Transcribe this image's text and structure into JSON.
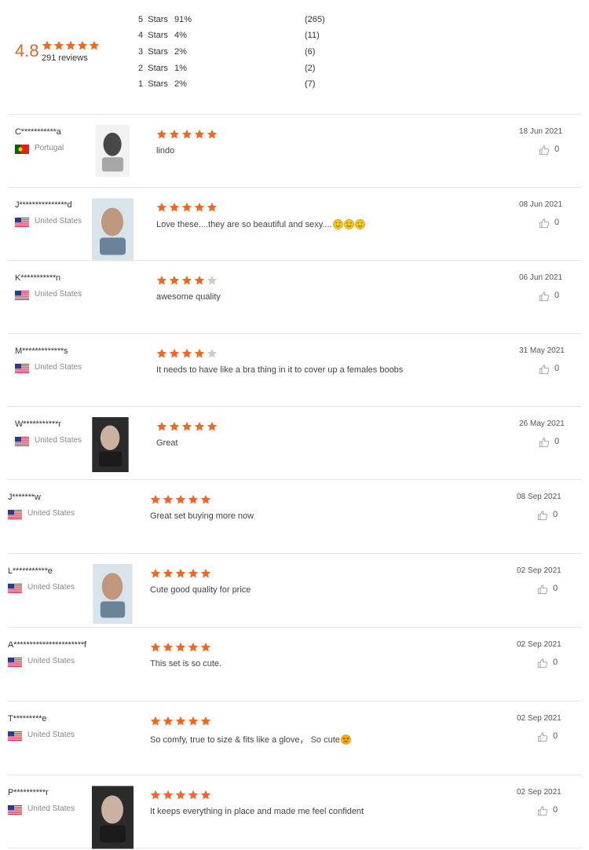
{
  "summary": {
    "average": "4.8",
    "total_reviews": "291 reviews",
    "distribution": [
      {
        "label": "5  Stars",
        "percent": "91%",
        "count": "(265)"
      },
      {
        "label": "4  Stars",
        "percent": "4%",
        "count": "(11)"
      },
      {
        "label": "3  Stars",
        "percent": "2%",
        "count": "(6)"
      },
      {
        "label": "2  Stars",
        "percent": "1%",
        "count": "(2)"
      },
      {
        "label": "1  Stars",
        "percent": "2%",
        "count": "(7)"
      }
    ]
  },
  "colors": {
    "star_filled": "#f26522",
    "star_empty": "#cccccc",
    "accent": "#e8641b"
  },
  "reviews": [
    {
      "name": "C***********a",
      "country": "Portugal",
      "flag": "portugal-flag",
      "has_photo": true,
      "stars": 5,
      "text": "lindo",
      "emojis": [],
      "date": "18 Jun 2021",
      "likes": "0"
    },
    {
      "name": "J***************d",
      "country": "United States",
      "flag": "us-flag",
      "has_photo": true,
      "stars": 5,
      "text": "Love these....they are so beautiful and sexy....",
      "emojis": [
        "smile-emoji",
        "smile-emoji",
        "smile-emoji"
      ],
      "date": "08 Jun 2021",
      "likes": "0"
    },
    {
      "name": "K***********n",
      "country": "United States",
      "flag": "us-flag",
      "has_photo": false,
      "stars": 4,
      "text": "awesome quality",
      "emojis": [],
      "date": "06 Jun 2021",
      "likes": "0"
    },
    {
      "name": "M*************s",
      "country": "United States",
      "flag": "us-flag",
      "has_photo": false,
      "stars": 4,
      "text": "It needs to have like a bra thing in it to cover up a females boobs",
      "emojis": [],
      "date": "31 May 2021",
      "likes": "0"
    },
    {
      "name": "W***********r",
      "country": "United States",
      "flag": "us-flag",
      "has_photo": true,
      "stars": 5,
      "text": "Great",
      "emojis": [],
      "date": "26 May 2021",
      "likes": "0"
    },
    {
      "name": "J*******w",
      "country": "United States",
      "flag": "us-flag",
      "has_photo": false,
      "stars": 5,
      "text": "Great set buying more now",
      "emojis": [],
      "date": "08 Sep 2021",
      "likes": "0"
    },
    {
      "name": "L***********e",
      "country": "United States",
      "flag": "us-flag",
      "has_photo": true,
      "stars": 5,
      "text": "Cute good quality for price",
      "emojis": [],
      "date": "02 Sep 2021",
      "likes": "0"
    },
    {
      "name": "A**********************f",
      "country": "United States",
      "flag": "us-flag",
      "has_photo": false,
      "stars": 5,
      "text": "This set is so cute.",
      "emojis": [],
      "date": "02 Sep 2021",
      "likes": "0"
    },
    {
      "name": "T*********e",
      "country": "United States",
      "flag": "us-flag",
      "has_photo": false,
      "stars": 5,
      "text": "So comfy, true to size & fits like a glove， So cute",
      "emojis": [
        "heart-eyes-emoji"
      ],
      "date": "02 Sep 2021",
      "likes": "0"
    },
    {
      "name": "P**********r",
      "country": "United States",
      "flag": "us-flag",
      "has_photo": true,
      "stars": 5,
      "text": "It keeps everything in place and made me feel confident",
      "emojis": [],
      "date": "02 Sep 2021",
      "likes": "0"
    }
  ]
}
